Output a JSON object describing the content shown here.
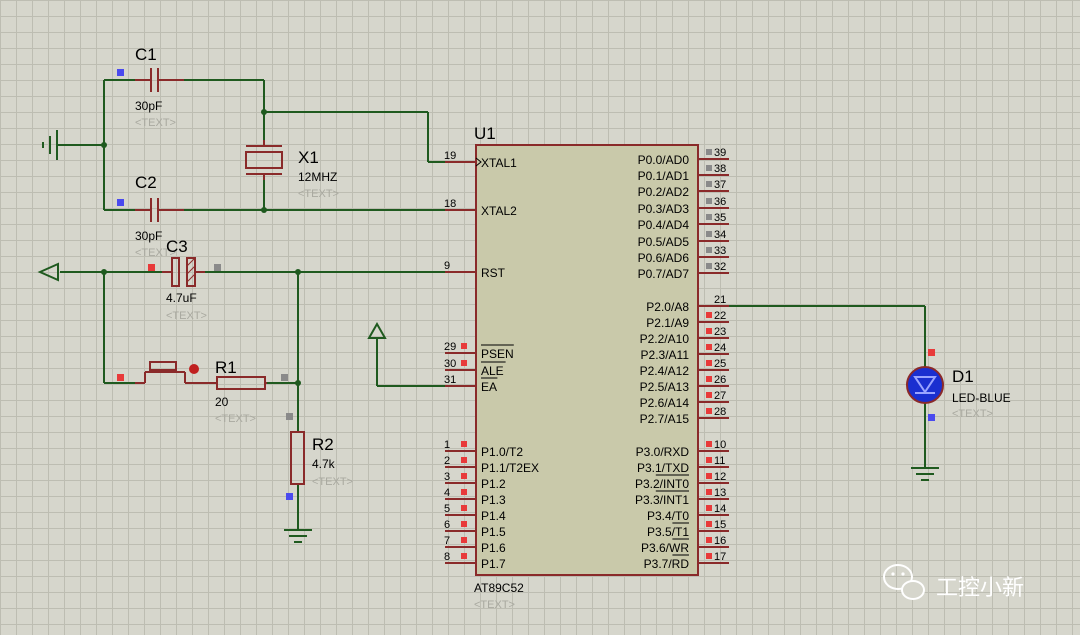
{
  "components": {
    "c1": {
      "ref": "C1",
      "value": "30pF",
      "text": "<TEXT>"
    },
    "c2": {
      "ref": "C2",
      "value": "30pF",
      "text": "<TEXT>"
    },
    "c3": {
      "ref": "C3",
      "value": "4.7uF",
      "text": "<TEXT>"
    },
    "x1": {
      "ref": "X1",
      "value": "12MHZ",
      "text": "<TEXT>"
    },
    "r1": {
      "ref": "R1",
      "value": "20",
      "text": "<TEXT>"
    },
    "r2": {
      "ref": "R2",
      "value": "4.7k",
      "text": "<TEXT>"
    },
    "d1": {
      "ref": "D1",
      "value": "LED-BLUE",
      "text": "<TEXT>"
    },
    "u1": {
      "ref": "U1",
      "value": "AT89C52",
      "text": "<TEXT>"
    }
  },
  "u1_left_pins": [
    {
      "num": "19",
      "name": "XTAL1"
    },
    {
      "num": "18",
      "name": "XTAL2"
    },
    {
      "num": "9",
      "name": "RST"
    },
    {
      "num": "29",
      "name": "PSEN"
    },
    {
      "num": "30",
      "name": "ALE"
    },
    {
      "num": "31",
      "name": "EA"
    },
    {
      "num": "1",
      "name": "P1.0/T2"
    },
    {
      "num": "2",
      "name": "P1.1/T2EX"
    },
    {
      "num": "3",
      "name": "P1.2"
    },
    {
      "num": "4",
      "name": "P1.3"
    },
    {
      "num": "5",
      "name": "P1.4"
    },
    {
      "num": "6",
      "name": "P1.5"
    },
    {
      "num": "7",
      "name": "P1.6"
    },
    {
      "num": "8",
      "name": "P1.7"
    }
  ],
  "u1_right_pins": [
    {
      "num": "39",
      "name": "P0.0/AD0"
    },
    {
      "num": "38",
      "name": "P0.1/AD1"
    },
    {
      "num": "37",
      "name": "P0.2/AD2"
    },
    {
      "num": "36",
      "name": "P0.3/AD3"
    },
    {
      "num": "35",
      "name": "P0.4/AD4"
    },
    {
      "num": "34",
      "name": "P0.5/AD5"
    },
    {
      "num": "33",
      "name": "P0.6/AD6"
    },
    {
      "num": "32",
      "name": "P0.7/AD7"
    },
    {
      "num": "21",
      "name": "P2.0/A8"
    },
    {
      "num": "22",
      "name": "P2.1/A9"
    },
    {
      "num": "23",
      "name": "P2.2/A10"
    },
    {
      "num": "24",
      "name": "P2.3/A11"
    },
    {
      "num": "25",
      "name": "P2.4/A12"
    },
    {
      "num": "26",
      "name": "P2.5/A13"
    },
    {
      "num": "27",
      "name": "P2.6/A14"
    },
    {
      "num": "28",
      "name": "P2.7/A15"
    },
    {
      "num": "10",
      "name": "P3.0/RXD"
    },
    {
      "num": "11",
      "name": "P3.1/TXD"
    },
    {
      "num": "12",
      "name": "P3.2/INT0"
    },
    {
      "num": "13",
      "name": "P3.3/INT1"
    },
    {
      "num": "14",
      "name": "P3.4/T0"
    },
    {
      "num": "15",
      "name": "P3.5/T1"
    },
    {
      "num": "16",
      "name": "P3.6/WR"
    },
    {
      "num": "17",
      "name": "P3.7/RD"
    }
  ],
  "watermark": "工控小新",
  "colors": {
    "wire": "#1f5a1f",
    "component": "#8a2a2a",
    "chip_fill": "#c9c9aa",
    "led": "#1a2fd0",
    "pin_red": "#e83a3a",
    "pin_blue": "#4a4aee",
    "pin_gray": "#8a8a8a"
  }
}
